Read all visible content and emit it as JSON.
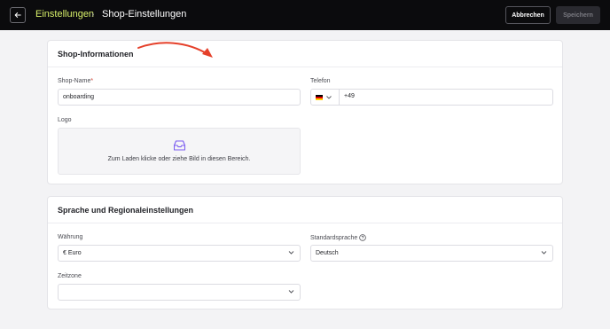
{
  "header": {
    "breadcrumb_parent": "Einstellungen",
    "breadcrumb_sep": "›",
    "breadcrumb_current": "Shop-Einstellungen",
    "cancel_label": "Abbrechen",
    "save_label": "Speichern",
    "back_icon": "arrow-left-icon"
  },
  "shop_info": {
    "title": "Shop-Informationen",
    "shop_name_label": "Shop-Name",
    "shop_name_required": "*",
    "shop_name_value": "onboarding",
    "phone_label": "Telefon",
    "phone_country_icon": "germany-flag-icon",
    "phone_value": "+49",
    "logo_label": "Logo",
    "logo_icon": "inbox-icon",
    "logo_hint": "Zum Laden klicke oder ziehe Bild in diesen Bereich."
  },
  "regional": {
    "title": "Sprache und Regionaleinstellungen",
    "currency_label": "Währung",
    "currency_value": "€ Euro",
    "language_label": "Standardsprache",
    "language_help_icon": "question-circle-icon",
    "language_value": "Deutsch",
    "timezone_label": "Zeitzone",
    "timezone_value": ""
  },
  "colors": {
    "topbar": "#0b0b0d",
    "breadcrumb_accent": "#d8f06a",
    "annotation_arrow": "#e5402a",
    "logo_icon": "#7a5cf0",
    "required": "#d03a2b"
  }
}
